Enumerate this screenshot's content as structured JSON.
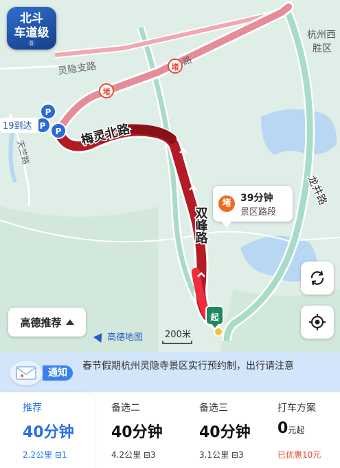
{
  "map": {
    "badge": {
      "line1": "北斗",
      "line2": "车道级",
      "line3": "Ⓑ"
    },
    "road_labels": {
      "lingyin_branch": "灵隐支路",
      "meiling_north": "梅灵北路",
      "shuangfeng": "双峰路",
      "longjing": "龙井路",
      "tianzhu": "天竺路",
      "hangzhou_district": "杭州西",
      "district_line2": "胜区"
    },
    "congestion_sign": "堵",
    "parking_sign": "P",
    "arrive_label": "19到达",
    "start_sign": "起",
    "callout": {
      "icon": "堵",
      "time": "39分钟",
      "desc": "景区路段"
    },
    "recommend_button": "高德推荐",
    "logo": "高德地图",
    "scale": "200米",
    "colors": {
      "congestion_light": "#e37f8f",
      "congestion_heavy": "#b31b25",
      "route_border": "#ffffff"
    }
  },
  "notice": {
    "tag": "通知",
    "text": "春节假期杭州灵隐寺景区实行预约制，出行请注意"
  },
  "routes": [
    {
      "label": "推荐",
      "time": "40分钟",
      "distance": "2.2公里",
      "lights": "1",
      "selected": true
    },
    {
      "label": "备选二",
      "time": "40分钟",
      "distance": "4.2公里",
      "lights": "3"
    },
    {
      "label": "备选三",
      "time": "40分钟",
      "distance": "3.1公里",
      "lights": "3"
    },
    {
      "label": "打车方案",
      "price": "0",
      "price_unit": "元起",
      "discount": "已优惠10元"
    }
  ]
}
